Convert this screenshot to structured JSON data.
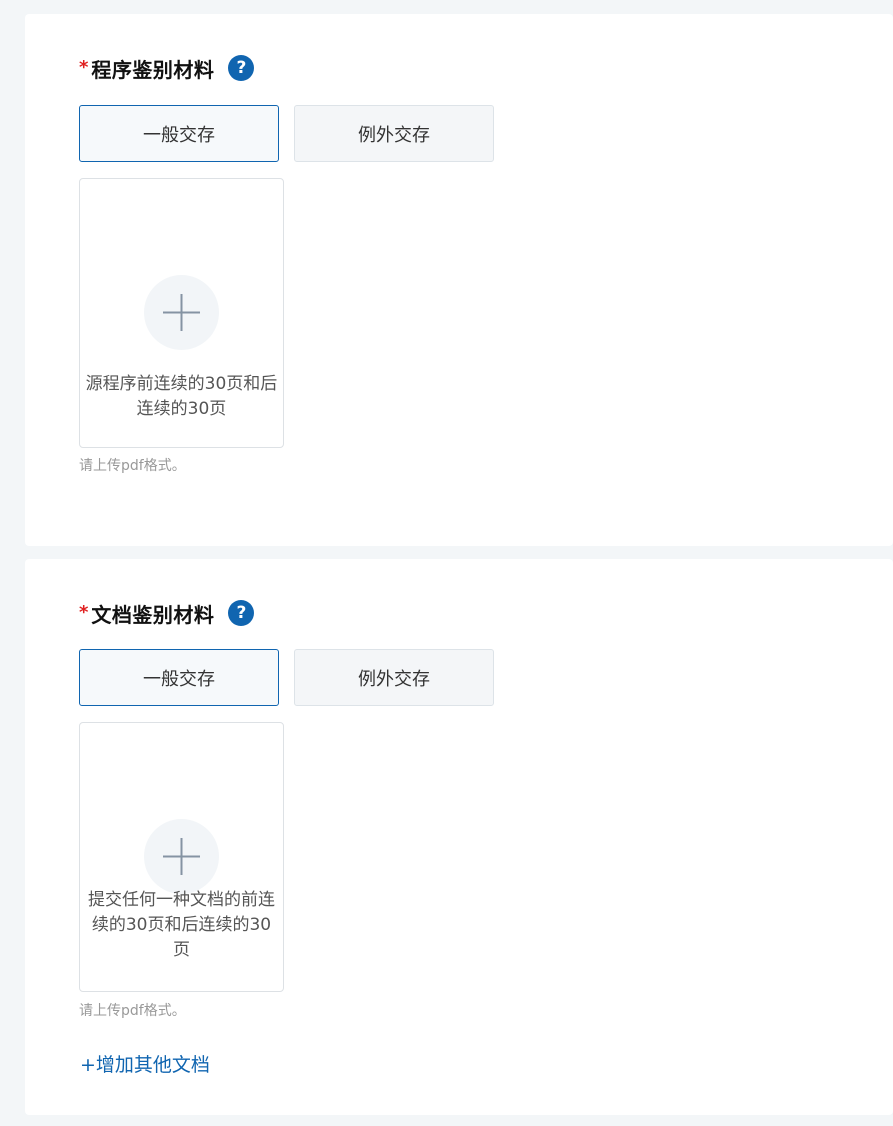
{
  "sections": [
    {
      "required_mark": "*",
      "title": "程序鉴别材料",
      "help_icon": "?",
      "tabs": [
        {
          "label": "一般交存",
          "active": true
        },
        {
          "label": "例外交存",
          "active": false
        }
      ],
      "upload": {
        "icon": "plus-icon",
        "text": "源程序前连续的30页和后连续的30页"
      },
      "hint": "请上传pdf格式。"
    },
    {
      "required_mark": "*",
      "title": "文档鉴别材料",
      "help_icon": "?",
      "tabs": [
        {
          "label": "一般交存",
          "active": true
        },
        {
          "label": "例外交存",
          "active": false
        }
      ],
      "upload": {
        "icon": "plus-icon",
        "text": "提交任何一种文档的前连续的30页和后连续的30页"
      },
      "hint": "请上传pdf格式。",
      "add_link": "+增加其他文档"
    }
  ],
  "colors": {
    "accent": "#1065b0",
    "required": "#e02020",
    "page_bg": "#f3f6f8"
  }
}
